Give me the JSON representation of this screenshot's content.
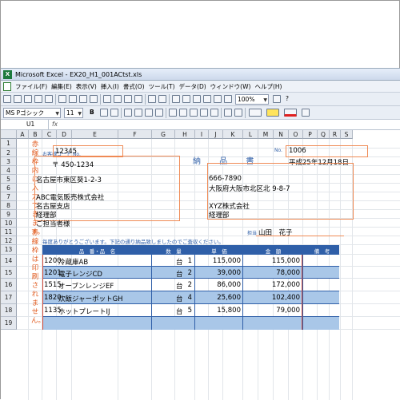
{
  "window": {
    "title": "Microsoft Excel - EX20_H1_001ACtst.xls",
    "app_icon_text": "X"
  },
  "menu": [
    "ファイル(F)",
    "編集(E)",
    "表示(V)",
    "挿入(I)",
    "書式(O)",
    "ツール(T)",
    "データ(D)",
    "ウィンドウ(W)",
    "ヘルプ(H)"
  ],
  "toolbar": {
    "zoom": "100%",
    "help_label": "?",
    "font_name": "MS Pゴシック",
    "font_size": "11",
    "bold": "B"
  },
  "formula": {
    "cell_ref": "U1",
    "fx_label": "fx",
    "value": ""
  },
  "columns": [
    "A",
    "B",
    "C",
    "D",
    "E",
    "F",
    "G",
    "H",
    "I",
    "J",
    "K",
    "L",
    "M",
    "N",
    "O",
    "P",
    "Q",
    "R",
    "S"
  ],
  "rows": [
    "1",
    "2",
    "3",
    "4",
    "5",
    "6",
    "7",
    "8",
    "9",
    "10",
    "11",
    "12",
    "13",
    "14",
    "15",
    "16",
    "17",
    "18",
    "19"
  ],
  "sidebar": {
    "left_note": "赤線枠内に入力できます。",
    "right_note": "赤線枠は印刷されません。"
  },
  "form": {
    "customer_code_label": "お客様コード No.",
    "customer_code": "12345",
    "title": "納 品 書",
    "no_label": "No.",
    "no_value": "1006",
    "date": "平成25年12月18日",
    "recipient": {
      "postal": "〒 450-1234",
      "address": "名古屋市東区葵1-2-3",
      "company": "ABC電気販売株式会社",
      "branch": "名古屋支店",
      "department": "経理部",
      "person": "ご担当者様"
    },
    "sender": {
      "postal": "666-7890",
      "address": "大阪府大阪市北区北 9-8-7",
      "company": "XYZ株式会社",
      "department": "経理部"
    },
    "person_in_charge_label": "担当",
    "person_in_charge": "山田　花子",
    "thanks": "毎度ありがとうございます。下記の通り納品致しましたのでご査収ください。"
  },
  "table": {
    "headers": [
      "品　番・品　名",
      "数　量",
      "単　価",
      "金　額",
      "備　考"
    ],
    "rows": [
      {
        "code": "1200",
        "name": "冷蔵庫AB",
        "qty": "1",
        "unit": "台",
        "price": "115,000",
        "amount": "115,000"
      },
      {
        "code": "1201",
        "name": "電子レンジCD",
        "qty": "2",
        "unit": "台",
        "price": "39,000",
        "amount": "78,000"
      },
      {
        "code": "1515",
        "name": "オーブンレンジEF",
        "qty": "2",
        "unit": "台",
        "price": "86,000",
        "amount": "172,000"
      },
      {
        "code": "1820",
        "name": "炊飯ジャーポットGH",
        "qty": "4",
        "unit": "台",
        "price": "25,600",
        "amount": "102,400"
      },
      {
        "code": "1135",
        "name": "ホットプレートIJ",
        "qty": "5",
        "unit": "台",
        "price": "15,800",
        "amount": "79,000"
      }
    ]
  },
  "colors": {
    "accent_blue": "#2f5fa8",
    "band_blue": "#a9c7e8",
    "orange": "#ef8a55",
    "red_line": "#d24a3a"
  }
}
